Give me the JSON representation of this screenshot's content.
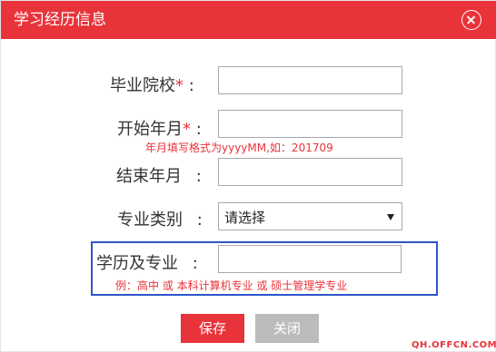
{
  "dialog": {
    "title": "学习经历信息",
    "close_icon": "close-circle-icon"
  },
  "form": {
    "school": {
      "label": "毕业院校",
      "required_mark": "*",
      "colon": ":",
      "value": ""
    },
    "start": {
      "label": "开始年月",
      "required_mark": "*",
      "colon": ":",
      "value": "",
      "hint": "年月填写格式为yyyyMM,如：201709"
    },
    "end": {
      "label": "结束年月",
      "colon": ":",
      "value": ""
    },
    "major_category": {
      "label": "专业类别",
      "colon": ":",
      "selected": "请选择"
    },
    "degree_major": {
      "label": "学历及专业",
      "colon": ":",
      "value": "",
      "hint": "例：高中 或 本科计算机专业 或 硕士管理学专业"
    }
  },
  "buttons": {
    "save": "保存",
    "close": "关闭"
  },
  "watermark": "QH.OFFCN.COM",
  "colors": {
    "accent": "#e8333a",
    "highlight": "#2e55c9",
    "disabled_button": "#bcbcbc"
  }
}
